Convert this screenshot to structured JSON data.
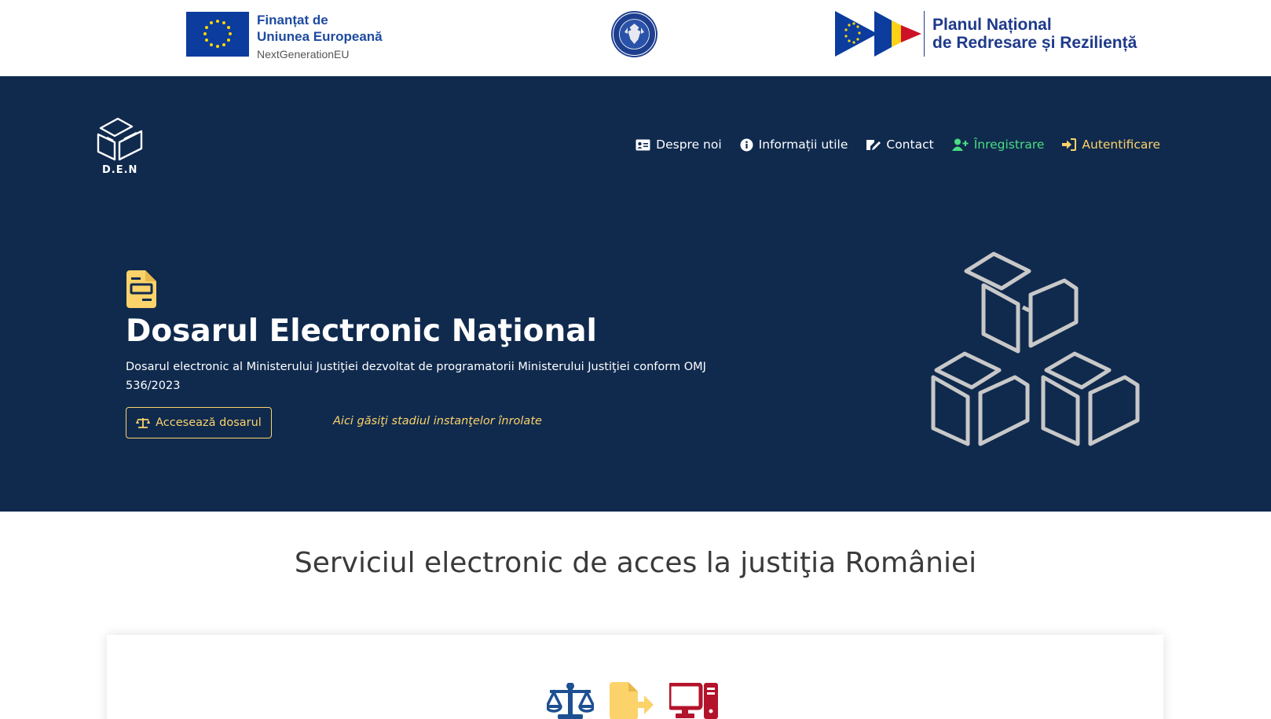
{
  "funding": {
    "eu_line1": "Finanțat de",
    "eu_line2": "Uniunea Europeană",
    "eu_line3": "NextGenerationEU",
    "pnrr_line1": "Planul Național",
    "pnrr_line2": "de Redresare și Reziliență"
  },
  "brand": {
    "text": "D.E.N"
  },
  "nav": {
    "about": "Despre noi",
    "info": "Informații utile",
    "contact": "Contact",
    "register": "Înregistrare",
    "login": "Autentificare"
  },
  "hero": {
    "title": "Dosarul Electronic Naţional",
    "subtitle": "Dosarul electronic al Ministerului Justiţiei dezvoltat de programatorii Ministerului Justiţiei conform OMJ 536/2023",
    "access_button": "Accesează dosarul",
    "status_link": "Aici găsiţi stadiul instanţelor înrolate"
  },
  "section": {
    "title": "Serviciul electronic de acces la justiţia României"
  },
  "icons": [
    "file-icon",
    "balance-scale-icon",
    "file-export-icon",
    "computer-icon",
    "user-plus-icon",
    "sign-in-icon",
    "id-card-icon",
    "info-icon",
    "edit-icon"
  ],
  "colors": {
    "hero_bg": "#102a4e",
    "accent_yellow": "#fbd36a",
    "accent_green": "#4ade80",
    "scale_blue": "#1d4f91",
    "computer_red": "#b3132b"
  }
}
